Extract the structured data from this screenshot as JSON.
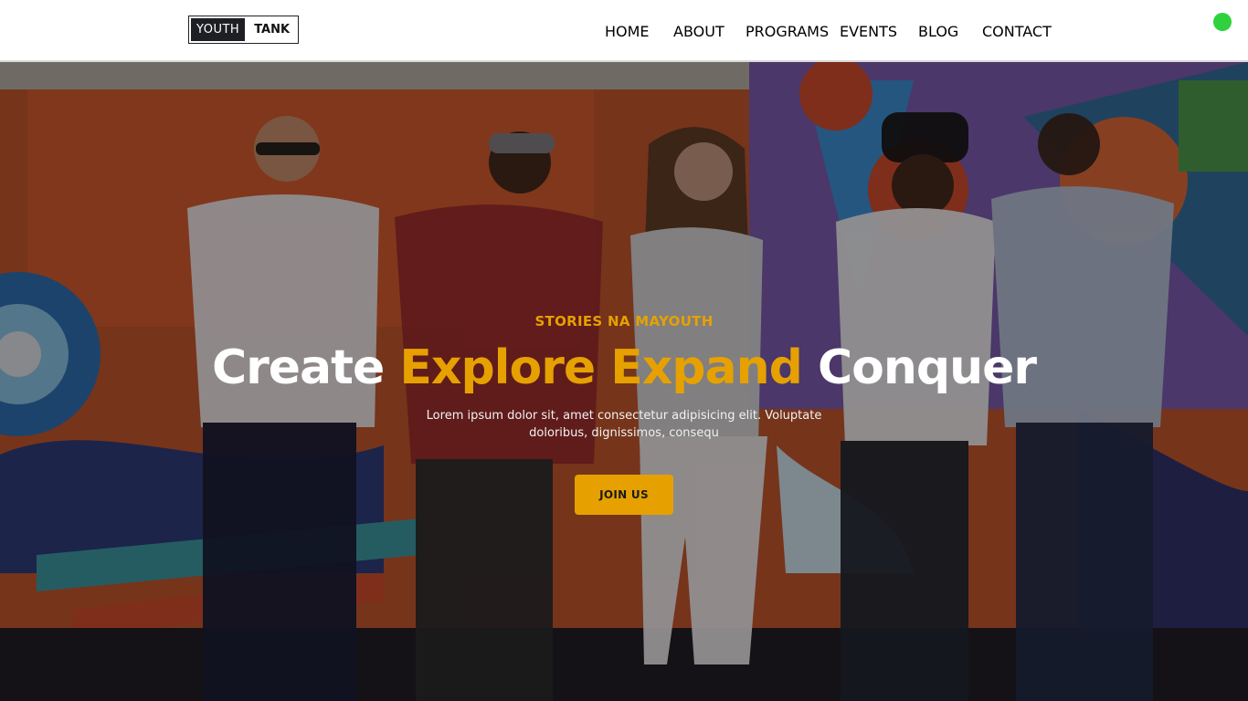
{
  "logo": {
    "part_a": "YOUTH",
    "part_b": "TANK"
  },
  "nav": [
    {
      "label": "HOME"
    },
    {
      "label": "ABOUT"
    },
    {
      "label": "PROGRAMS"
    },
    {
      "label": "EVENTS"
    },
    {
      "label": "BLOG"
    },
    {
      "label": "CONTACT"
    }
  ],
  "status_dot_color": "#2fd13e",
  "hero": {
    "kicker": "STORIES NA MAYOUTH",
    "headline": {
      "w1": "Create",
      "w2": "Explore",
      "w3": "Expand",
      "w4": "Conquer"
    },
    "subtext": "Lorem ipsum dolor sit, amet consectetur adipisicing elit. Voluptate doloribus, dignissimos, consequ",
    "cta_label": "JOIN US",
    "image_icon": "group-photo-graffiti-wall"
  },
  "colors": {
    "accent": "#e6a100",
    "nav_text": "#111111",
    "navbar_bg": "#ffffff"
  }
}
